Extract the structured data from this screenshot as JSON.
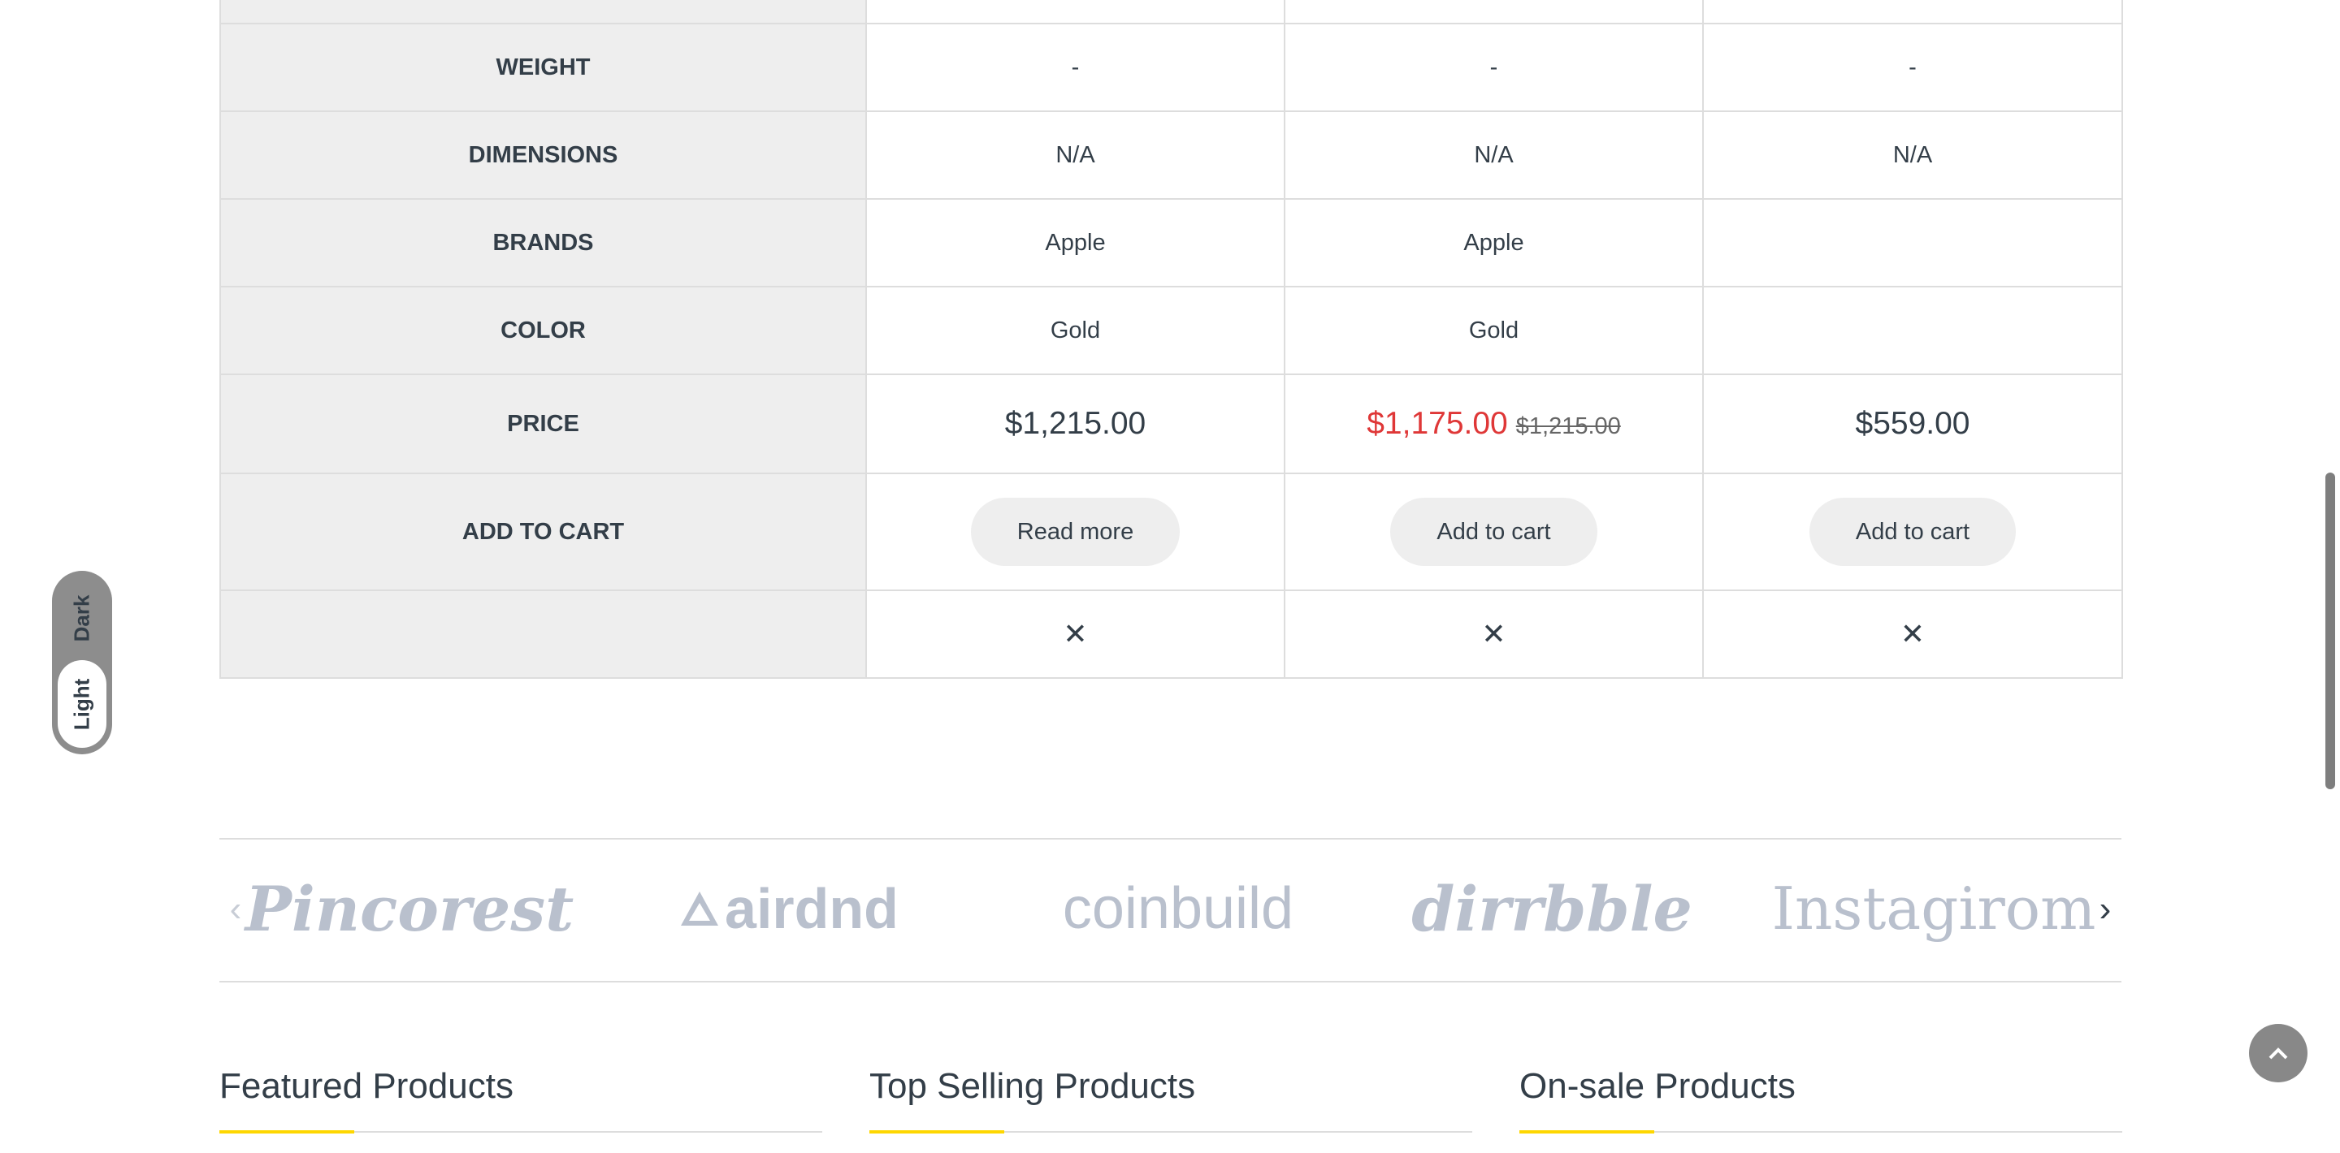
{
  "compare": {
    "rows": {
      "weight": {
        "label": "WEIGHT",
        "values": [
          "-",
          "-",
          "-"
        ]
      },
      "dimensions": {
        "label": "DIMENSIONS",
        "values": [
          "N/A",
          "N/A",
          "N/A"
        ]
      },
      "brands": {
        "label": "BRANDS",
        "values": [
          "Apple",
          "Apple",
          ""
        ]
      },
      "color": {
        "label": "COLOR",
        "values": [
          "Gold",
          "Gold",
          ""
        ]
      },
      "price": {
        "label": "PRICE",
        "p1": "$1,215.00",
        "p2_sale": "$1,175.00",
        "p2_regular": "$1,215.00",
        "p3": "$559.00"
      },
      "cart": {
        "label": "ADD TO CART",
        "buttons": [
          "Read more",
          "Add to cart",
          "Add to cart"
        ]
      },
      "remove": {
        "icon": "close-icon",
        "glyph": "✕"
      }
    }
  },
  "theme_switch": {
    "dark_label": "Dark",
    "light_label": "Light",
    "selected": "Light"
  },
  "brand_carousel": {
    "logos": [
      "Pincorest",
      "airdnd",
      "coinbuild",
      "dirrbble",
      "Instagirom"
    ],
    "prev_icon": "chevron-left-icon",
    "next_icon": "chevron-right-icon"
  },
  "sections": {
    "featured": "Featured Products",
    "top_selling": "Top Selling Products",
    "on_sale": "On-sale Products"
  },
  "back_to_top": {
    "icon": "chevron-up-icon"
  },
  "colors": {
    "sale": "#df3737",
    "accent": "#fed700",
    "label_bg": "#eeeeee"
  }
}
